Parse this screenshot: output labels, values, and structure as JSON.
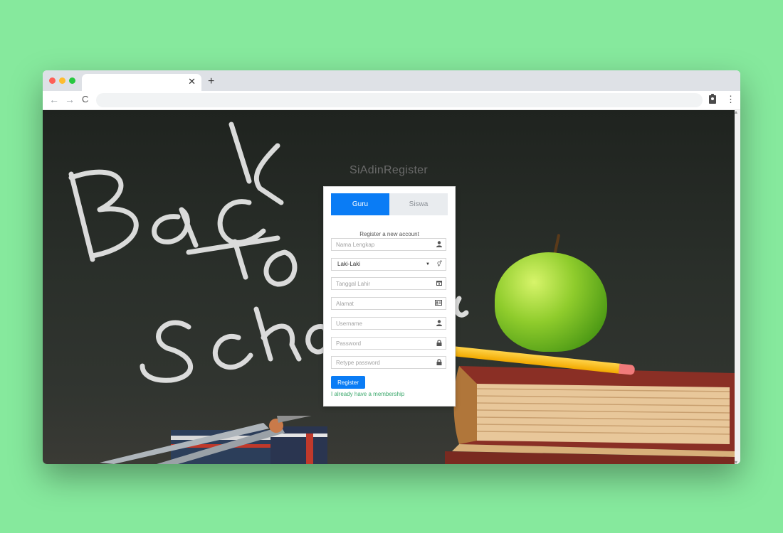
{
  "browser": {
    "tab_title": "",
    "tab_close": "✕",
    "new_tab": "+",
    "back": "←",
    "forward": "→",
    "reload": "C",
    "address": "",
    "menu": "⋮"
  },
  "page": {
    "title": "SiAdinRegister",
    "role_tabs": [
      {
        "label": "Guru",
        "active": true
      },
      {
        "label": "Siswa",
        "active": false
      }
    ],
    "caption": "Register a new account",
    "fields": {
      "full_name": {
        "placeholder": "Nama Lengkap",
        "icon": "user-icon"
      },
      "gender": {
        "value": "Laki-Laki",
        "icon": "gender-icon"
      },
      "birth_date": {
        "placeholder": "Tanggal Lahir",
        "icon": "calendar-icon"
      },
      "address": {
        "placeholder": "Alamat",
        "icon": "id-card-icon"
      },
      "username": {
        "placeholder": "Username",
        "icon": "user-icon"
      },
      "password": {
        "placeholder": "Password",
        "icon": "lock-icon"
      },
      "retype_password": {
        "placeholder": "Retype password",
        "icon": "lock-icon"
      }
    },
    "register_button": "Register",
    "membership_link": "I already have a membership"
  },
  "colors": {
    "desktop": "#86e99d",
    "accent": "#0a7cf5",
    "link": "#3aa86b"
  }
}
